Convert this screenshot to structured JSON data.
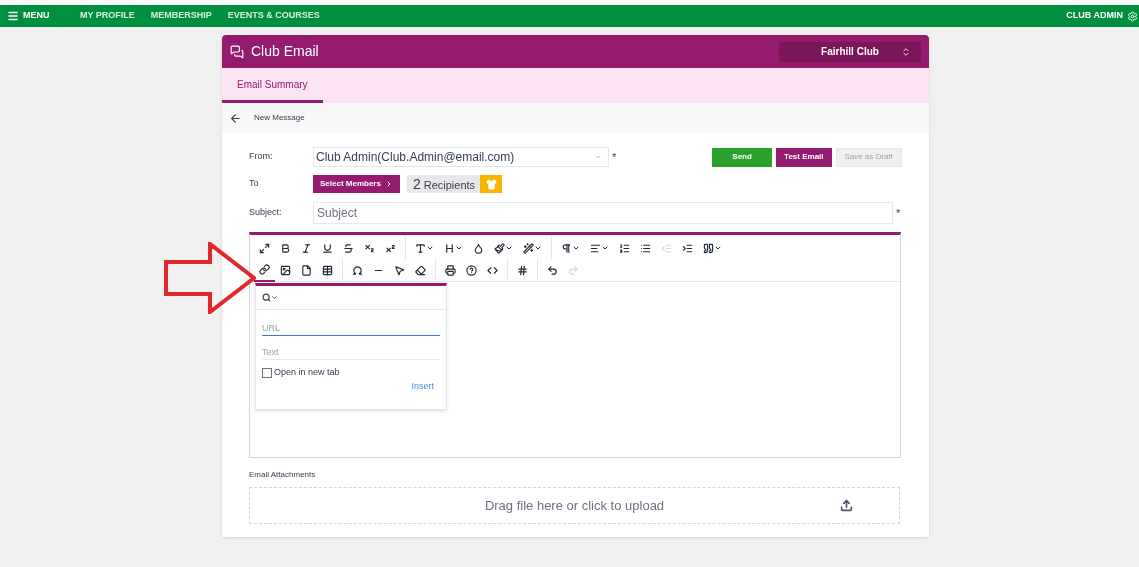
{
  "topbar": {
    "menu": "MENU",
    "links": [
      "MY PROFILE",
      "MEMBERSHIP",
      "EVENTS & COURSES"
    ],
    "user": "CLUB ADMIN"
  },
  "card": {
    "title": "Club Email",
    "club_select": "Fairhill Club"
  },
  "tabs": [
    {
      "label": "Email Summary",
      "selected": true
    }
  ],
  "breadcrumb": "New Message",
  "form": {
    "from_label": "From:",
    "from_value": "Club Admin(Club.Admin@email.com)",
    "to_label": "To",
    "select_members": "Select Members",
    "recipients_count": "2",
    "recipients_label": "Recipients",
    "subject_label": "Subject:",
    "subject_placeholder": "Subject",
    "required_mark": "*"
  },
  "actions": [
    {
      "label": "Send",
      "kind": "send",
      "disabled": false
    },
    {
      "label": "Test Email",
      "kind": "test",
      "disabled": false
    },
    {
      "label": "Save as Draft",
      "kind": "draft",
      "disabled": true
    }
  ],
  "toolbar": [
    [
      {
        "kind": "expand"
      },
      {
        "kind": "bold"
      },
      {
        "kind": "italic"
      },
      {
        "kind": "underline"
      },
      {
        "kind": "strike"
      },
      {
        "kind": "subscript"
      },
      {
        "kind": "superscript"
      },
      {
        "kind": "font",
        "sep": true,
        "caret": true
      },
      {
        "kind": "size",
        "caret": true
      },
      {
        "kind": "drop"
      },
      {
        "kind": "brush",
        "caret": true
      },
      {
        "kind": "wand",
        "caret": true
      },
      {
        "kind": "pilcrow",
        "sep": true,
        "caret": true
      },
      {
        "kind": "align",
        "caret": true
      },
      {
        "kind": "ol"
      },
      {
        "kind": "ul"
      },
      {
        "kind": "outdent",
        "disabled": true
      },
      {
        "kind": "indent"
      },
      {
        "kind": "quote",
        "caret": true
      }
    ],
    [
      {
        "kind": "link",
        "active": true
      },
      {
        "kind": "image"
      },
      {
        "kind": "file"
      },
      {
        "kind": "table"
      },
      {
        "kind": "omega",
        "sep": true
      },
      {
        "kind": "hr"
      },
      {
        "kind": "pointer"
      },
      {
        "kind": "eraser"
      },
      {
        "kind": "print",
        "sep": true
      },
      {
        "kind": "help"
      },
      {
        "kind": "code"
      },
      {
        "kind": "hash",
        "sep": true
      },
      {
        "kind": "undo",
        "sep": true
      },
      {
        "kind": "redo",
        "disabled": true
      }
    ]
  ],
  "link_popup": {
    "url_placeholder": "URL",
    "text_placeholder": "Text",
    "new_tab_label": "Open in new tab",
    "new_tab_checked": false,
    "insert": "Insert"
  },
  "attachments": {
    "label": "Email Attachments",
    "dropzone": "Drag file here or click to upload"
  }
}
